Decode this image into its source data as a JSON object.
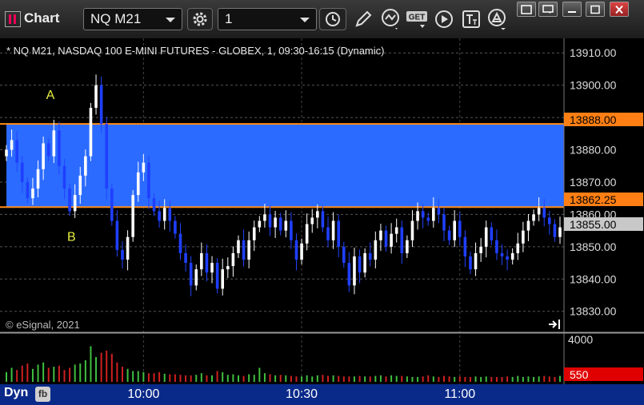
{
  "toolbar": {
    "app_title": "Chart",
    "symbol": "NQ M21",
    "interval": "1",
    "study_button_label": "GET"
  },
  "chart_data": {
    "type": "candlestick",
    "title": "* NQ M21, NASDAQ 100 E-MINI FUTURES - GLOBEX, 1, 09:30-16:15 (Dynamic)",
    "copyright": "© eSignal, 2021",
    "price_axis": {
      "ticks": [
        "13910.00",
        "13900.00",
        "13890.00",
        "13880.00",
        "13870.00",
        "13860.00",
        "13850.00",
        "13840.00",
        "13830.00"
      ],
      "tick_values": [
        13910,
        13900,
        13890,
        13880,
        13870,
        13860,
        13850,
        13840,
        13830
      ],
      "ylim": [
        13823.5,
        13914.5
      ]
    },
    "time_axis": {
      "labels": [
        "10:00",
        "10:30",
        "11:00"
      ],
      "label_bar_index": [
        26,
        56,
        86
      ],
      "bar_count": 106
    },
    "zone": {
      "high": 13888.0,
      "low": 13862.25,
      "high_label": "13888.00",
      "low_label": "13862.25",
      "color": "#2b6bff"
    },
    "last_price": {
      "value": 13855.0,
      "label": "13855.00"
    },
    "annotations": [
      {
        "text": "A",
        "bar": 13,
        "price": 13897
      },
      {
        "text": "B",
        "bar": 17,
        "price": 13853
      }
    ],
    "volume_axis": {
      "tick_label": "4000",
      "tick_value": 4000,
      "last_label": "550",
      "last_value": 550,
      "ylim": [
        0,
        4000
      ]
    },
    "closes": [
      13880,
      13883,
      13876,
      13870,
      13865,
      13868,
      13874,
      13882,
      13878,
      13886,
      13875,
      13868,
      13861,
      13866,
      13872,
      13878,
      13893,
      13900,
      13888,
      13868,
      13858,
      13849,
      13846,
      13853,
      13866,
      13873,
      13876,
      13865,
      13861,
      13858,
      13862,
      13858,
      13854,
      13848,
      13845,
      13838,
      13843,
      13848,
      13842,
      13845,
      13837,
      13843,
      13844,
      13848,
      13852,
      13846,
      13852,
      13856,
      13858,
      13860,
      13856,
      13859,
      13855,
      13858,
      13852,
      13846,
      13851,
      13857,
      13859,
      13861,
      13856,
      13852,
      13858,
      13850,
      13845,
      13838,
      13847,
      13842,
      13848,
      13846,
      13852,
      13855,
      13850,
      13854,
      13856,
      13848,
      13852,
      13858,
      13861,
      13859,
      13858,
      13862,
      13860,
      13855,
      13852,
      13858,
      13853,
      13847,
      13843,
      13848,
      13850,
      13856,
      13852,
      13848,
      13847,
      13846,
      13848,
      13851,
      13855,
      13858,
      13860,
      13862,
      13859,
      13857,
      13853,
      13856
    ],
    "volumes": [
      900,
      1300,
      1100,
      1500,
      1700,
      1200,
      1600,
      1800,
      1300,
      1400,
      1500,
      1100,
      1300,
      1600,
      1700,
      2000,
      3300,
      2300,
      2700,
      2900,
      2600,
      1800,
      1400,
      1200,
      1000,
      1000,
      900,
      800,
      800,
      900,
      750,
      700,
      700,
      650,
      600,
      600,
      650,
      800,
      600,
      600,
      1000,
      900,
      650,
      700,
      600,
      550,
      700,
      650,
      1300,
      800,
      700,
      600,
      650,
      600,
      550,
      500,
      500,
      600,
      500,
      600,
      650,
      550,
      600,
      550,
      500,
      500,
      500,
      550,
      500,
      500,
      550,
      600,
      500,
      600,
      550,
      550,
      500,
      450,
      450,
      500,
      600,
      500,
      450,
      550,
      500,
      450,
      500,
      450,
      450,
      500,
      450,
      500,
      450,
      450,
      450,
      500,
      450,
      550,
      450,
      500,
      450,
      500,
      550,
      500,
      450,
      550
    ]
  }
}
